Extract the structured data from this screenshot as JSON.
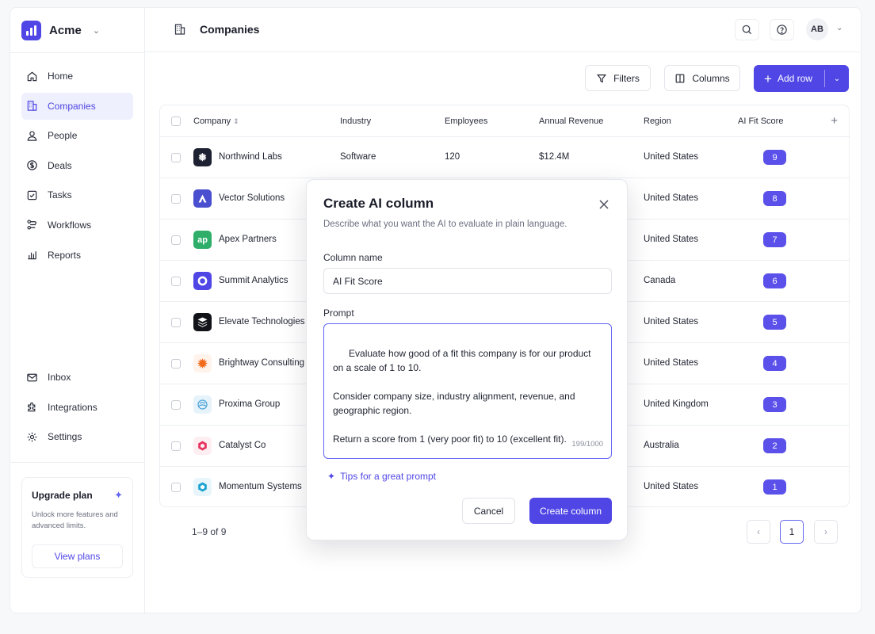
{
  "brand": {
    "name": "Acme"
  },
  "nav": {
    "primary": [
      {
        "label": "Home",
        "icon": "home-icon"
      },
      {
        "label": "Companies",
        "icon": "building-icon",
        "active": true
      },
      {
        "label": "People",
        "icon": "person-icon"
      },
      {
        "label": "Deals",
        "icon": "dollar-icon"
      },
      {
        "label": "Tasks",
        "icon": "checkbox-icon"
      },
      {
        "label": "Workflows",
        "icon": "workflow-icon"
      },
      {
        "label": "Reports",
        "icon": "bar-chart-icon"
      }
    ],
    "secondary": [
      {
        "label": "Inbox",
        "icon": "mail-icon"
      },
      {
        "label": "Integrations",
        "icon": "puzzle-icon"
      },
      {
        "label": "Settings",
        "icon": "gear-icon"
      }
    ]
  },
  "upgrade": {
    "title": "Upgrade plan",
    "text": "Unlock more features and advanced limits.",
    "button": "View plans"
  },
  "header": {
    "title": "Companies",
    "avatar_initials": "AB"
  },
  "toolbar": {
    "filters": "Filters",
    "columns": "Columns",
    "add_row": "Add row"
  },
  "table": {
    "columns": [
      "Company",
      "Industry",
      "Employees",
      "Annual Revenue",
      "Region",
      "AI Fit Score"
    ],
    "rows": [
      {
        "company": "Northwind Labs",
        "industry": "Software",
        "employees": "120",
        "revenue": "$12.4M",
        "region": "United States",
        "score": "9",
        "logo": "snowflake",
        "logo_color": "#1e2132"
      },
      {
        "company": "Vector Solutions",
        "industry": "",
        "employees": "",
        "revenue": "",
        "region": "United States",
        "score": "8",
        "logo": "A",
        "logo_color": "#4a4fcf"
      },
      {
        "company": "Apex Partners",
        "industry": "",
        "employees": "",
        "revenue": "",
        "region": "United States",
        "score": "7",
        "logo": "ap",
        "logo_color": "#2fae6a"
      },
      {
        "company": "Summit Analytics",
        "industry": "",
        "employees": "",
        "revenue": "",
        "region": "Canada",
        "score": "6",
        "logo": "ring",
        "logo_color": "#4f46e5"
      },
      {
        "company": "Elevate Technologies",
        "industry": "",
        "employees": "",
        "revenue": "",
        "region": "United States",
        "score": "5",
        "logo": "layers",
        "logo_color": "#111318"
      },
      {
        "company": "Brightway Consulting",
        "industry": "",
        "employees": "",
        "revenue": "",
        "region": "United States",
        "score": "4",
        "logo": "sun",
        "logo_color": "#fff3ec"
      },
      {
        "company": "Proxima Group",
        "industry": "",
        "employees": "",
        "revenue": "",
        "region": "United Kingdom",
        "score": "3",
        "logo": "shell",
        "logo_color": "#e6f3fb"
      },
      {
        "company": "Catalyst Co",
        "industry": "",
        "employees": "",
        "revenue": "",
        "region": "Australia",
        "score": "2",
        "logo": "hex",
        "logo_color": "#fdeef2"
      },
      {
        "company": "Momentum Systems",
        "industry": "",
        "employees": "",
        "revenue": "",
        "region": "United States",
        "score": "1",
        "logo": "hexagon",
        "logo_color": "#e8f6fb"
      }
    ]
  },
  "pager": {
    "info": "1–9 of 9",
    "current": "1"
  },
  "modal": {
    "title": "Create AI column",
    "description": "Describe what you want the AI to evaluate in plain language.",
    "column_name_label": "Column name",
    "column_name_value": "AI Fit Score",
    "prompt_label": "Prompt",
    "prompt_text": "Evaluate how good of a fit this company is for our product\non a scale of 1 to 10.\n\nConsider company size, industry alignment, revenue, and\ngeographic region.\n\nReturn a score from 1 (very poor fit) to 10 (excellent fit).",
    "char_count": "199/1000",
    "tips": "Tips for a great prompt",
    "cancel": "Cancel",
    "create": "Create column"
  },
  "colors": {
    "accent": "#4f46e5",
    "score_badge": "#5b50ea"
  }
}
